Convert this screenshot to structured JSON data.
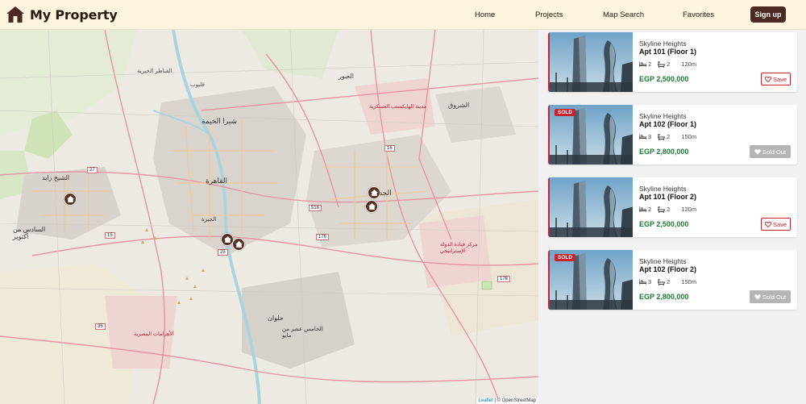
{
  "header": {
    "brand": "My Property",
    "nav": [
      "Home",
      "Projects",
      "Map Search",
      "Favorites"
    ],
    "signup": "Sign up"
  },
  "map": {
    "attribution_leaflet": "Leaflet",
    "attribution_rest": "| © OpenStreetMap",
    "labels": [
      "القناطر الخيرية",
      "قليوب",
      "العبور",
      "شبرا الخيمة",
      "مدينة الهايكستب العسكرية",
      "الشروق",
      "القاهرة",
      "الجيزة",
      "الجديدة",
      "الشيخ زايد",
      "السادس من أكتوبر",
      "حلوان",
      "الخامس عشر من مايو",
      "مركز قيادة الدولة الإستراتيجي",
      "الأهرامات المصرية"
    ],
    "road_numbers": [
      "16",
      "27",
      "516",
      "176",
      "25",
      "35",
      "15",
      "176"
    ]
  },
  "colors": {
    "accent": "#4a2a22",
    "marker": "#5b2f1f",
    "price": "#1e7a32",
    "sold": "#c8232c"
  },
  "listings": [
    {
      "project": "Skyline Heights",
      "unit": "Apt 101 (Floor 1)",
      "beds": "2",
      "baths": "2",
      "area": "120m",
      "price": "EGP 2,500,000",
      "sold": false,
      "badge": "",
      "action": "Save"
    },
    {
      "project": "Skyline Heights",
      "unit": "Apt 102 (Floor 1)",
      "beds": "3",
      "baths": "2",
      "area": "150m",
      "price": "EGP 2,800,000",
      "sold": true,
      "badge": "SOLD",
      "action": "Sold Out"
    },
    {
      "project": "Skyline Heights",
      "unit": "Apt 101 (Floor 2)",
      "beds": "2",
      "baths": "2",
      "area": "120m",
      "price": "EGP 2,500,000",
      "sold": false,
      "badge": "",
      "action": "Save"
    },
    {
      "project": "Skyline Heights",
      "unit": "Apt 102 (Floor 2)",
      "beds": "3",
      "baths": "2",
      "area": "150m",
      "price": "EGP 2,800,000",
      "sold": true,
      "badge": "SOLD",
      "action": "Sold Out"
    }
  ]
}
